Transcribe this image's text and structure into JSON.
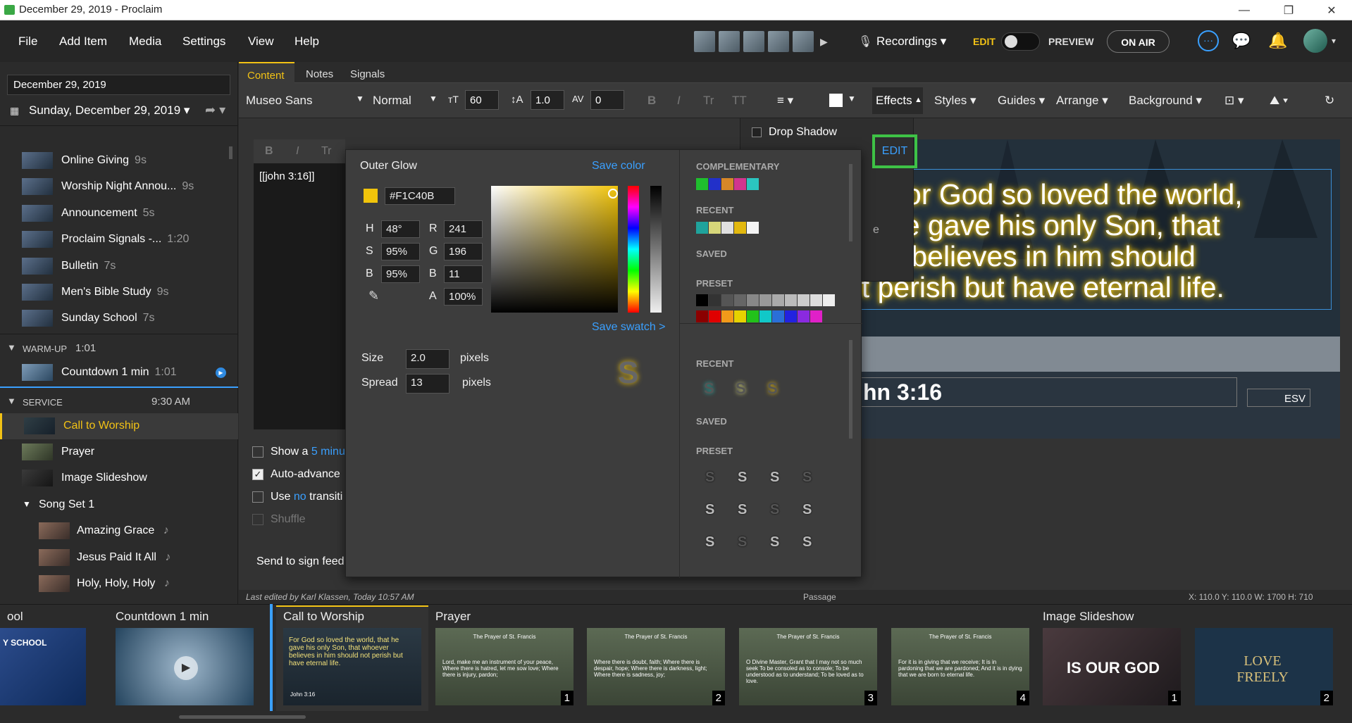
{
  "window": {
    "title": "December 29, 2019 - Proclaim"
  },
  "menu": {
    "items": [
      "File",
      "Add Item",
      "Media",
      "Settings",
      "View",
      "Help"
    ],
    "recordings": "Recordings",
    "edit": "EDIT",
    "preview": "PREVIEW",
    "on_air": "ON AIR"
  },
  "sidebar": {
    "date_field": "December 29, 2019",
    "service_date": "Sunday, December 29, 2019",
    "pre_items": [
      {
        "name": "Online Giving",
        "time": "9s"
      },
      {
        "name": "Worship Night Annou...",
        "time": "9s"
      },
      {
        "name": "Announcement",
        "time": "5s"
      },
      {
        "name": "Proclaim Signals -...",
        "time": "1:20"
      },
      {
        "name": "Bulletin",
        "time": "7s"
      },
      {
        "name": "Men's Bible Study",
        "time": "9s"
      },
      {
        "name": "Sunday School",
        "time": "7s"
      }
    ],
    "warmup": {
      "label": "WARM-UP",
      "time": "1:01"
    },
    "countdown": {
      "name": "Countdown 1 min",
      "time": "1:01"
    },
    "service": {
      "label": "SERVICE",
      "time": "9:30 AM"
    },
    "service_items": [
      "Call to Worship",
      "Prayer",
      "Image Slideshow"
    ],
    "songset": "Song Set 1",
    "songs": [
      "Amazing Grace",
      "Jesus Paid It All",
      "Holy, Holy, Holy"
    ]
  },
  "tabs": [
    "Content",
    "Notes",
    "Signals"
  ],
  "toolbar": {
    "font": "Museo Sans",
    "weight": "Normal",
    "size": "60",
    "line_height": "1.0",
    "spacing": "0",
    "effects": "Effects",
    "styles": "Styles",
    "guides": "Guides",
    "arrange": "Arrange",
    "background": "Background"
  },
  "editor": {
    "text": "[[john 3:16]]"
  },
  "options": {
    "show_a": "Show a",
    "minutes_link": "5 minu",
    "auto_advance": "Auto-advance",
    "use": "Use",
    "no_link": "no",
    "transition": "transiti",
    "shuffle": "Shuffle",
    "send": "Send to sign feed"
  },
  "effects_menu": {
    "drop_shadow": "Drop Shadow",
    "edit_label": "EDIT"
  },
  "glow": {
    "title": "Outer Glow",
    "save_color": "Save color",
    "hex": "#F1C40B",
    "h": "48°",
    "s": "95%",
    "b": "95%",
    "r": "241",
    "g": "196",
    "b2": "11",
    "a": "100%",
    "save_swatch": "Save swatch >",
    "size_label": "Size",
    "size": "2.0",
    "spread_label": "Spread",
    "spread": "13",
    "unit": "pixels",
    "sections": {
      "complementary": "COMPLEMENTARY",
      "recent": "RECENT",
      "saved": "SAVED",
      "preset": "PRESET"
    },
    "complementary_colors": [
      "#1fbf2d",
      "#2230c9",
      "#d68728",
      "#d1358f",
      "#2bc5c0"
    ],
    "recent_colors": [
      "#1fa39c",
      "#d6d67a",
      "#e0e0e0",
      "#e2b80f",
      "#f4f4f4"
    ]
  },
  "preview": {
    "verse_lines": [
      "For God so loved the world,",
      "he gave his only Son, that",
      "ver believes in him should",
      "ot perish but have eternal life."
    ],
    "reference": "hn 3:16",
    "version": "ESV"
  },
  "status": {
    "left": "Last edited by Karl Klassen, Today 10:57 AM",
    "mid": "Passage",
    "right": "X: 110.0  Y: 110.0  W: 1700  H: 710"
  },
  "filmstrip": {
    "titles": [
      "ool",
      "Countdown 1 min",
      "Call to Worship",
      "Prayer",
      "Image Slideshow"
    ],
    "school_text": "Y SCHOOL",
    "prayer_title": "The Prayer of St. Francis",
    "call_text": "For God so loved the world, that he gave his only Son, that whoever believes in him should not perish but have eternal life.",
    "call_ref": "John 3:16",
    "prayer_texts": [
      "Lord, make me an instrument of your peace, Where there is hatred, let me sow love; Where there is injury, pardon;",
      "Where there is doubt, faith; Where there is despair, hope; Where there is darkness, light; Where there is sadness, joy;",
      "O Divine Master, Grant that I may not so much seek To be consoled as to console; To be understood as to understand; To be loved as to love.",
      "For it is in giving that we receive; It is in pardoning that we are pardoned; And it is in dying that we are born to eternal life."
    ],
    "slide_nums": [
      "1",
      "2",
      "3",
      "4",
      "1",
      "2"
    ],
    "fortress": "IS OUR GOD",
    "love": "LOVE FREELY"
  }
}
